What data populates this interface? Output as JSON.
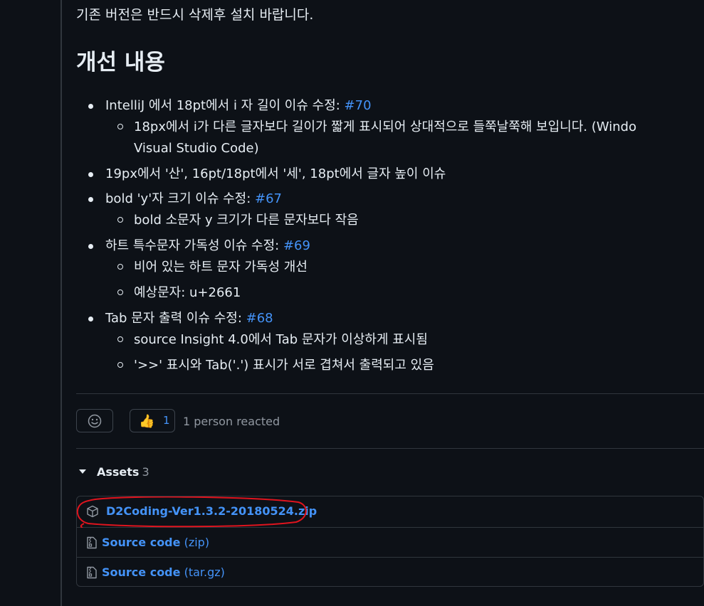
{
  "intro_text": "기존 버전은 반드시 삭제후 설치 바랍니다.",
  "section_heading": "개선 내용",
  "items": [
    {
      "text": "IntelliJ 에서 18pt에서 i 자 길이 이슈 수정: ",
      "ref": "#70",
      "subs": [
        {
          "line1": "18px에서 i가 다른 글자보다 길이가 짧게 표시되어 상대적으로 들쭉날쭉해 보입니다. (Windo",
          "line2": "Visual Studio Code)"
        }
      ]
    },
    {
      "text": "19px에서 '산', 16pt/18pt에서 '세', 18pt에서 글자 높이 이슈",
      "ref": "",
      "subs": []
    },
    {
      "text": "bold 'y'자 크기 이슈 수정: ",
      "ref": "#67",
      "subs": [
        {
          "line1": "bold 소문자 y 크기가 다른 문자보다 작음",
          "line2": ""
        }
      ]
    },
    {
      "text": "하트 특수문자 가독성 이슈 수정: ",
      "ref": "#69",
      "subs": [
        {
          "line1": "비어 있는 하트 문자 가독성 개선",
          "line2": ""
        },
        {
          "line1": "예상문자: u+2661",
          "line2": ""
        }
      ]
    },
    {
      "text": "Tab 문자 출력 이슈 수정: ",
      "ref": "#68",
      "subs": [
        {
          "line1": "source Insight 4.0에서 Tab 문자가 이상하게 표시됨",
          "line2": ""
        },
        {
          "line1": "'>>' 표시와 Tab('.') 표시가 서로 겹쳐서 출력되고 있음",
          "line2": ""
        }
      ]
    }
  ],
  "reactions": {
    "add_reaction_icon": "smiley-icon",
    "thumbs_emoji": "👍",
    "thumbs_count": "1",
    "summary": "1 person reacted"
  },
  "assets": {
    "title": "Assets",
    "count": "3",
    "files": [
      {
        "icon": "package-icon",
        "name": "D2Coding-Ver1.3.2-20180524.zip",
        "format": ""
      },
      {
        "icon": "file-zip-icon",
        "name": "Source code",
        "format": " (zip)"
      },
      {
        "icon": "file-zip-icon",
        "name": "Source code",
        "format": " (tar.gz)"
      }
    ]
  },
  "colors": {
    "background": "#0d1117",
    "text": "#e6edf3",
    "link": "#4493f8",
    "muted": "#9198a1",
    "border": "#30363d",
    "annotation_circle": "#e0141e"
  }
}
